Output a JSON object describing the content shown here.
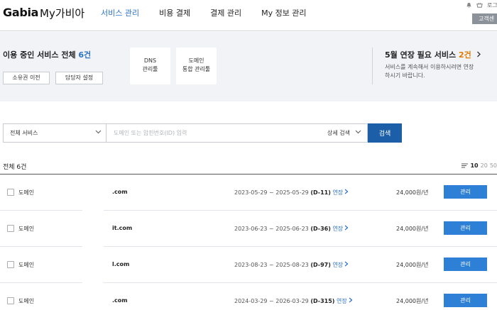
{
  "header": {
    "logo": "Gabia",
    "logo_sub": "My가비아",
    "nav": [
      "서비스 관리",
      "비용 결제",
      "결제 관리",
      "My 정보 관리"
    ],
    "util_link": "로그",
    "cs_button": "고객센"
  },
  "summary": {
    "title_prefix": "이용 중인 서비스 전체 ",
    "title_count": "6건",
    "btn_transfer": "소유권 이전",
    "btn_manager": "담당자 설정",
    "cards": [
      {
        "line1": "DNS",
        "line2": "관리툴"
      },
      {
        "line1": "도메인",
        "line2": "통합 관리툴"
      }
    ],
    "renew_prefix": "5월 연장 필요 서비스 ",
    "renew_count": "2건",
    "renew_desc": "서비스를 계속해서 이용하시려면 연장하시기 바랍니다."
  },
  "search": {
    "select_value": "전체 서비스",
    "placeholder": "도메인 또는 암핀번호(ID) 입력",
    "detail_label": "상세 검색",
    "button": "검색"
  },
  "list": {
    "total": "전체 6건",
    "pager": [
      "10",
      "20",
      "50"
    ],
    "rows": [
      {
        "type": "도메인",
        "domain": ".com",
        "period": "2023-05-29 ~ 2025-05-29",
        "dday": "(D-11)",
        "renew": "연장",
        "price": "24,000원/년",
        "manage": "관리"
      },
      {
        "type": "도메인",
        "domain": "it.com",
        "period": "2023-06-23 ~ 2025-06-23",
        "dday": "(D-36)",
        "renew": "연장",
        "price": "24,000원/년",
        "manage": "관리"
      },
      {
        "type": "도메인",
        "domain": "l.com",
        "period": "2023-08-23 ~ 2025-08-23",
        "dday": "(D-97)",
        "renew": "연장",
        "price": "24,000원/년",
        "manage": "관리"
      },
      {
        "type": "도메인",
        "domain": ".com",
        "period": "2024-03-29 ~ 2026-03-29",
        "dday": "(D-315)",
        "renew": "연장",
        "price": "24,000원/년",
        "manage": "관리"
      }
    ]
  },
  "colors": {
    "accent": "#2a72c8",
    "button": "#2e80d6",
    "search": "#1c5fa8",
    "highlight": "#e07b00"
  },
  "icons": [
    "bell-icon",
    "cart-icon",
    "chevron-down-icon",
    "chevron-right-icon",
    "list-icon"
  ]
}
